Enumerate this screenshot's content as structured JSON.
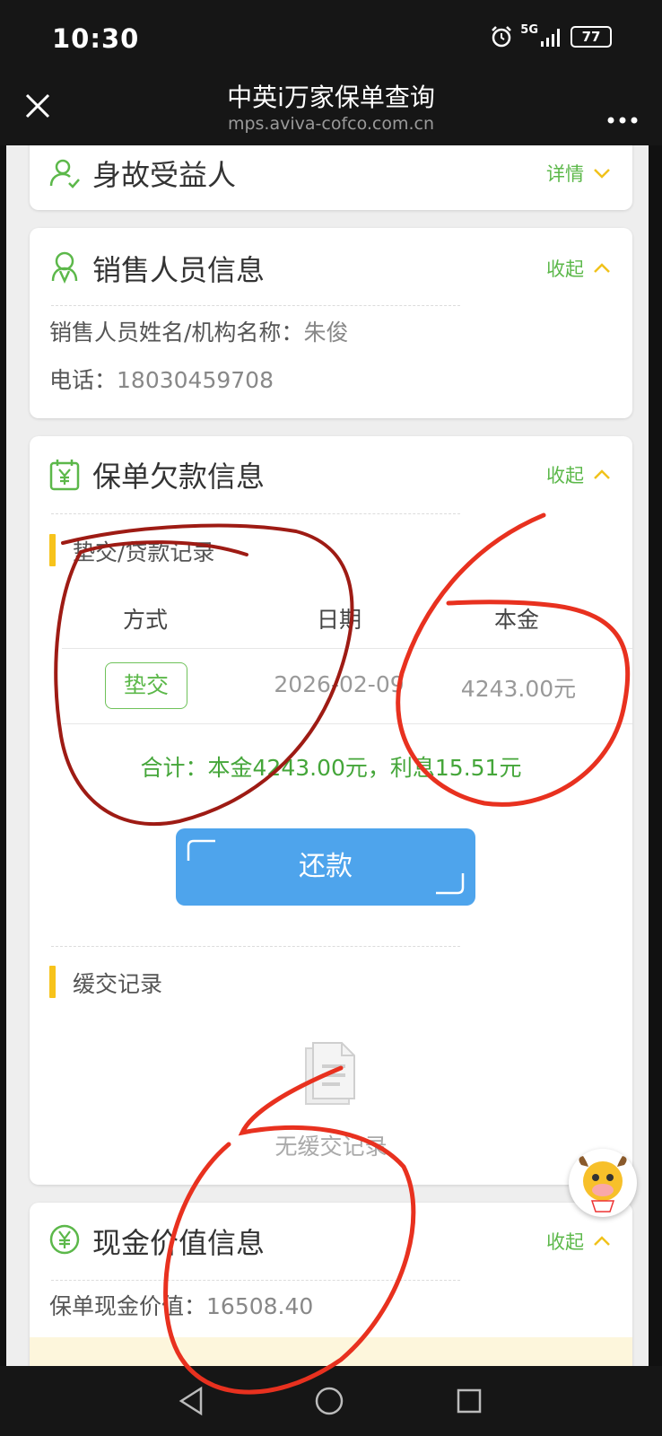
{
  "status_bar": {
    "time": "10:30",
    "network": "5G",
    "battery": "77"
  },
  "nav": {
    "title": "中英i万家保单查询",
    "url": "mps.aviva-cofco.com.cn"
  },
  "beneficiary": {
    "title": "身故受益人",
    "toggle": "详情"
  },
  "sales": {
    "title": "销售人员信息",
    "toggle": "收起",
    "name_label": "销售人员姓名/机构名称：",
    "name_value": "朱俊",
    "phone_label": "电话：",
    "phone_value": "18030459708"
  },
  "arrears": {
    "title": "保单欠款信息",
    "toggle": "收起",
    "records_title": "垫交/贷款记录",
    "table": {
      "headers": [
        "方式",
        "日期",
        "本金"
      ],
      "rows": [
        {
          "method": "垫交",
          "date": "2026-02-09",
          "principal": "4243.00元"
        }
      ]
    },
    "total": "合计：本金4243.00元，利息15.51元",
    "repay_label": "还款",
    "deferral_title": "缓交记录",
    "empty_text": "无缓交记录"
  },
  "cash_value": {
    "title": "现金价值信息",
    "toggle": "收起",
    "label": "保单现金价值：",
    "value": "16508.40"
  },
  "colors": {
    "accent_green": "#5cb84a",
    "repay_blue": "#4ea4ec",
    "section_yellow": "#f7c31b",
    "annotation_red": "#e8311f"
  }
}
